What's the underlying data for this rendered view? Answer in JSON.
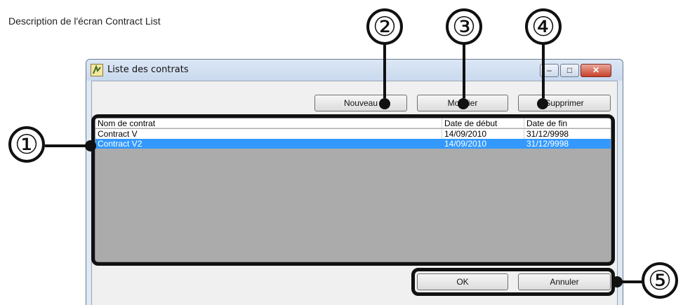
{
  "caption": "Description de l'écran Contract List",
  "window": {
    "title": "Liste des contrats",
    "buttons": {
      "minimize": "–",
      "maximize": "□",
      "close": "✕"
    }
  },
  "toolbar": {
    "new_label": "Nouveau",
    "modify_label": "Modifier",
    "delete_label": "Supprimer"
  },
  "list": {
    "columns": [
      "Nom de contrat",
      "Date de début",
      "Date de fin"
    ],
    "rows": [
      {
        "name": "Contract V",
        "start": "14/09/2010",
        "end": "31/12/9998",
        "selected": false
      },
      {
        "name": "Contract V2",
        "start": "14/09/2010",
        "end": "31/12/9998",
        "selected": true
      }
    ]
  },
  "footer": {
    "ok_label": "OK",
    "cancel_label": "Annuler"
  },
  "annotations": {
    "n1": "①",
    "n2": "②",
    "n3": "③",
    "n4": "④",
    "n5": "⑤"
  },
  "icons": {
    "app": "app-icon",
    "minimize": "minimize-icon",
    "maximize": "maximize-icon",
    "close": "close-icon"
  },
  "colors": {
    "selection": "#3399ff",
    "list_background": "#ababab",
    "annotation": "#111111"
  }
}
